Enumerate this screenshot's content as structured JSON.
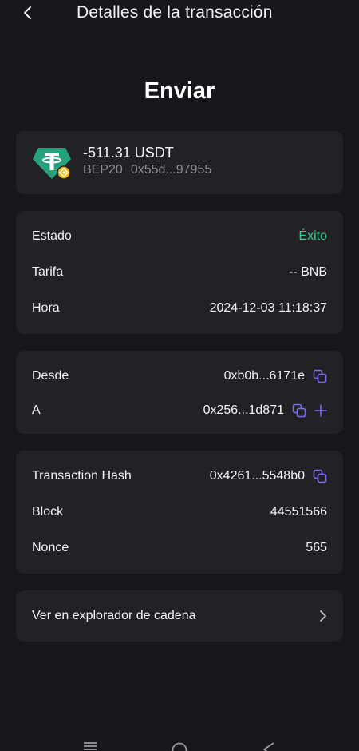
{
  "header": {
    "title": "Detalles de la transacción",
    "back_icon": "chevron-left-icon"
  },
  "page_title": "Enviar",
  "asset": {
    "amount": "-511.31 USDT",
    "network": "BEP20",
    "address": "0x55d...97955",
    "icon": "tether-usdt-icon",
    "badge_icon": "bnb-chain-badge-icon"
  },
  "status": {
    "estado_label": "Estado",
    "estado_value": "Éxito",
    "tarifa_label": "Tarifa",
    "tarifa_value": "-- BNB",
    "hora_label": "Hora",
    "hora_value": "2024-12-03 11:18:37"
  },
  "addresses": {
    "desde_label": "Desde",
    "desde_value": "0xb0b...6171e",
    "a_label": "A",
    "a_value": "0x256...1d871"
  },
  "hash": {
    "hash_label": "Transaction Hash",
    "hash_value": "0x4261...5548b0",
    "block_label": "Block",
    "block_value": "44551566",
    "nonce_label": "Nonce",
    "nonce_value": "565"
  },
  "explorer": {
    "label": "Ver en explorador de cadena",
    "icon": "chevron-right-icon"
  },
  "colors": {
    "background": "#17171b",
    "card": "#222226",
    "success": "#3fc68a",
    "accent": "#7b6cf6",
    "secondary_text": "#8e8e96"
  },
  "navbar": {
    "icons": [
      "menu-icon",
      "home-circle-icon",
      "back-triangle-icon"
    ]
  }
}
